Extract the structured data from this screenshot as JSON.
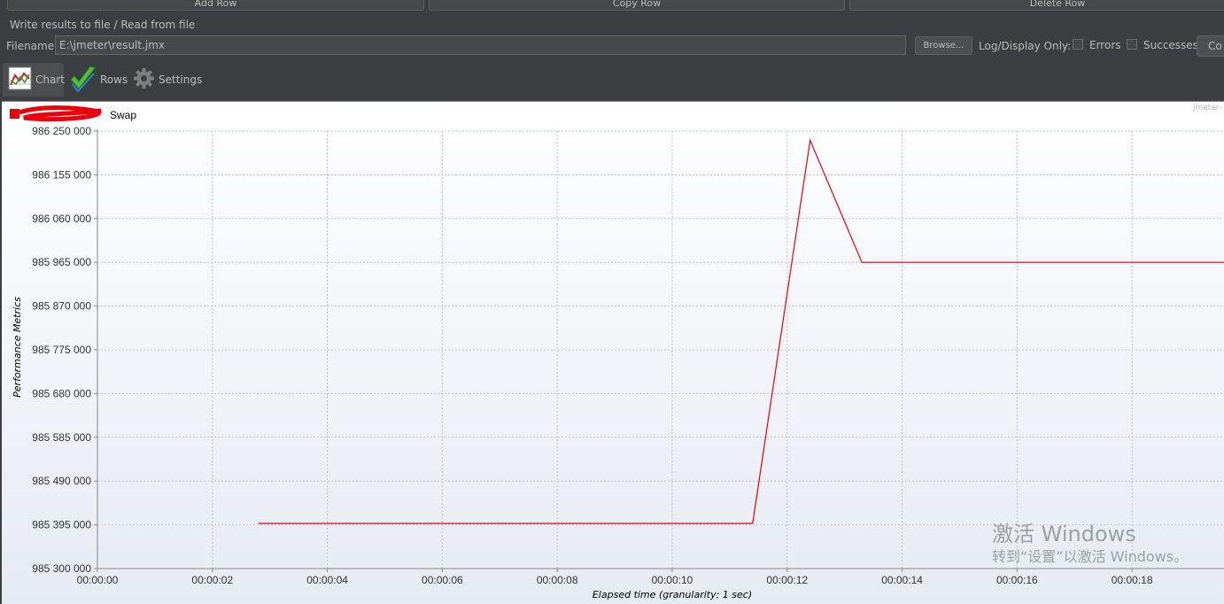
{
  "toolbar": {
    "add_row": "Add Row",
    "copy_row": "Copy Row",
    "delete_row": "Delete Row"
  },
  "file_section": {
    "title": "Write results to file / Read from file",
    "filename_label": "Filename",
    "filename_value": "E:\\jmeter\\result.jmx",
    "browse_label": "Browse...",
    "log_display_label": "Log/Display Only:",
    "errors_label": "Errors",
    "successes_label": "Successes",
    "configure_label": "Co"
  },
  "tabs": [
    {
      "label": "Chart",
      "icon": "chart-icon",
      "active": true
    },
    {
      "label": "Rows",
      "icon": "checkmark-icon",
      "active": false
    },
    {
      "label": "Settings",
      "icon": "gear-icon",
      "active": false
    }
  ],
  "chart_corner_text": "jmeter-",
  "chart_data": {
    "type": "line",
    "series": [
      {
        "name": "Swap",
        "color": "#e8000b",
        "x": [
          "00:00:02.8",
          "00:00:11.4",
          "00:00:12.4",
          "00:00:13.3",
          "00:00:19.6"
        ],
        "values": [
          985398000,
          985398000,
          986230000,
          985965000,
          985965000
        ]
      }
    ],
    "legend_text": "Swap",
    "legend_position": "top-left",
    "xlabel": "Elapsed time (granularity: 1 sec)",
    "ylabel": "Performance Metrics",
    "ylim": [
      985300000,
      986250000
    ],
    "yticks": [
      "986 250 000",
      "986 155 000",
      "986 060 000",
      "985 965 000",
      "985 870 000",
      "985 775 000",
      "985 680 000",
      "985 585 000",
      "985 490 000",
      "985 395 000",
      "985 300 000"
    ],
    "xticks": [
      "00:00:00",
      "00:00:02",
      "00:00:04",
      "00:00:06",
      "00:00:08",
      "00:00:10",
      "00:00:12",
      "00:00:14",
      "00:00:16",
      "00:00:18"
    ],
    "grid": true
  },
  "watermark": {
    "line1": "激活 Windows",
    "line2": "转到“设置”以激活 Windows。"
  }
}
